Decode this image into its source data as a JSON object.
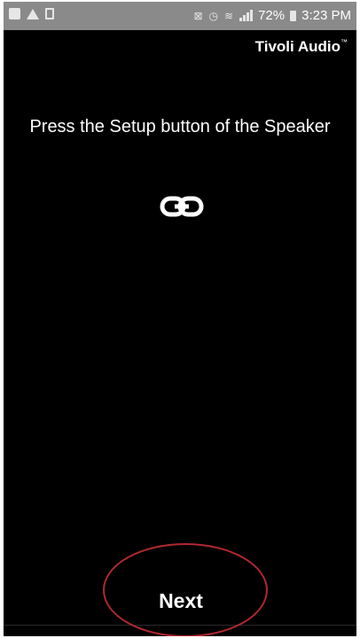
{
  "status_bar": {
    "battery_text": "72%",
    "time": "3:23 PM",
    "icons": [
      "notification-icon",
      "warning-icon",
      "clipboard-icon",
      "mute-icon",
      "alarm-icon",
      "wifi-icon",
      "signal-icon",
      "battery-icon"
    ]
  },
  "header": {
    "brand": "Tivoli Audio"
  },
  "main": {
    "instruction": "Press the Setup button of the Speaker",
    "icon": "link-icon"
  },
  "footer": {
    "next_label": "Next"
  },
  "colors": {
    "background": "#000000",
    "status_bar": "#8a8a8a",
    "text": "#ffffff",
    "highlight": "#b0282e"
  }
}
